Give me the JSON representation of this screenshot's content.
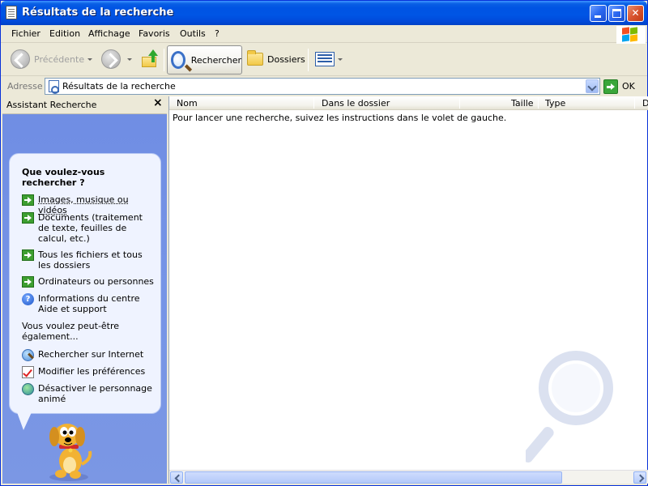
{
  "window": {
    "title": "Résultats de la recherche"
  },
  "menu": {
    "items": [
      "Fichier",
      "Edition",
      "Affichage",
      "Favoris",
      "Outils",
      "?"
    ]
  },
  "toolbar": {
    "back_label": "Précédente",
    "search_label": "Rechercher",
    "folders_label": "Dossiers"
  },
  "address": {
    "label": "Adresse",
    "value": "Résultats de la recherche",
    "go_label": "OK"
  },
  "search_pane": {
    "title": "Assistant Recherche",
    "close_glyph": "×",
    "question": "Que voulez-vous rechercher ?",
    "options": [
      {
        "label": "Images, musique ou vidéos",
        "icon": "green-arrow-icon"
      },
      {
        "label": "Documents (traitement de texte, feuilles de calcul, etc.)",
        "icon": "green-arrow-icon"
      },
      {
        "label": "Tous les fichiers et tous les dossiers",
        "icon": "green-arrow-icon"
      },
      {
        "label": "Ordinateurs ou personnes",
        "icon": "green-arrow-icon"
      },
      {
        "label": "Informations du centre Aide et support",
        "icon": "help-icon"
      }
    ],
    "also_label": "Vous voulez peut-être également...",
    "also_options": [
      {
        "label": "Rechercher sur Internet",
        "icon": "internet-search-icon"
      },
      {
        "label": "Modifier les préférences",
        "icon": "preferences-icon"
      },
      {
        "label": "Désactiver le personnage animé",
        "icon": "agent-icon"
      }
    ]
  },
  "results": {
    "columns": [
      "Nom",
      "Dans le dossier",
      "Taille",
      "Type",
      "D"
    ],
    "empty_message": "Pour lancer une recherche, suivez les instructions dans le volet de gauche."
  },
  "colors": {
    "titlebar": "#0054e3",
    "pane_background": "#7694e6",
    "bubble": "#eff3ff"
  }
}
